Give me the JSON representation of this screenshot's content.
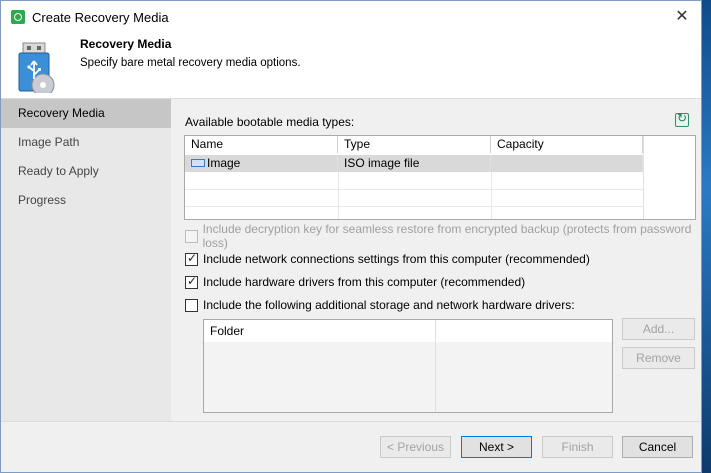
{
  "window": {
    "title": "Create Recovery Media",
    "close_glyph": "✕"
  },
  "header": {
    "title": "Recovery Media",
    "subtitle": "Specify bare metal recovery media options.",
    "icon": "usb-drive-icon"
  },
  "nav": {
    "items": [
      {
        "label": "Recovery Media",
        "active": true
      },
      {
        "label": "Image Path",
        "active": false
      },
      {
        "label": "Ready to Apply",
        "active": false
      },
      {
        "label": "Progress",
        "active": false
      }
    ]
  },
  "media": {
    "label": "Available bootable media types:",
    "columns": [
      "Name",
      "Type",
      "Capacity"
    ],
    "rows": [
      {
        "name": "Image",
        "type": "ISO image file",
        "capacity": ""
      }
    ]
  },
  "options": {
    "decryption_key": {
      "label": "Include decryption key for seamless restore from encrypted backup (protects from password loss)",
      "checked": false,
      "disabled": true
    },
    "network_settings": {
      "label": "Include network connections settings from this computer (recommended)",
      "checked": true
    },
    "hardware_drivers": {
      "label": "Include hardware drivers from this computer (recommended)",
      "checked": true
    },
    "additional_drivers": {
      "label": "Include the following additional storage and network hardware drivers:",
      "checked": false
    }
  },
  "folders": {
    "column": "Folder",
    "add_label": "Add...",
    "remove_label": "Remove"
  },
  "footer": {
    "previous_label": "< Previous",
    "next_label": "Next >",
    "finish_label": "Finish",
    "cancel_label": "Cancel"
  },
  "colors": {
    "accent": "#0078d7",
    "nav_active": "#c6c6c6",
    "selected_row": "#d9d9d9"
  }
}
